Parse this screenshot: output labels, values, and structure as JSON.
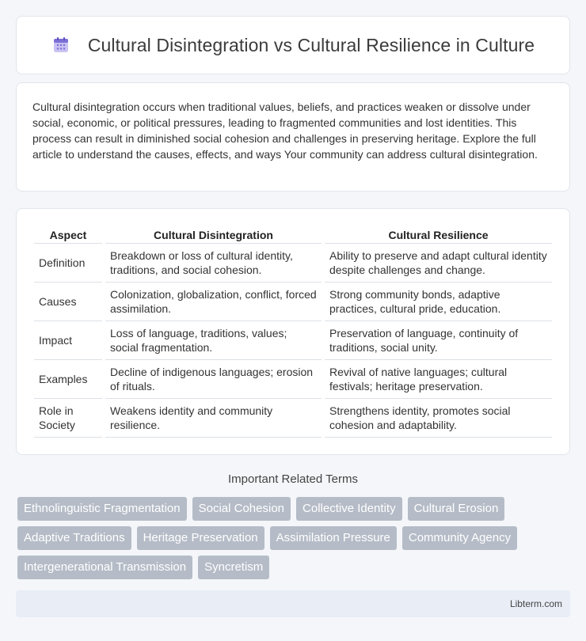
{
  "header": {
    "title": "Cultural Disintegration vs Cultural Resilience in Culture",
    "icon": "calendar-grid-icon"
  },
  "intro": {
    "text": "Cultural disintegration occurs when traditional values, beliefs, and practices weaken or dissolve under social, economic, or political pressures, leading to fragmented communities and lost identities. This process can result in diminished social cohesion and challenges in preserving heritage. Explore the full article to understand the causes, effects, and ways Your community can address cultural disintegration."
  },
  "table": {
    "headers": [
      "Aspect",
      "Cultural Disintegration",
      "Cultural Resilience"
    ],
    "rows": [
      [
        "Definition",
        "Breakdown or loss of cultural identity, traditions, and social cohesion.",
        "Ability to preserve and adapt cultural identity despite challenges and change."
      ],
      [
        "Causes",
        "Colonization, globalization, conflict, forced assimilation.",
        "Strong community bonds, adaptive practices, cultural pride, education."
      ],
      [
        "Impact",
        "Loss of language, traditions, values; social fragmentation.",
        "Preservation of language, continuity of traditions, social unity."
      ],
      [
        "Examples",
        "Decline of indigenous languages; erosion of rituals.",
        "Revival of native languages; cultural festivals; heritage preservation."
      ],
      [
        "Role in Society",
        "Weakens identity and community resilience.",
        "Strengthens identity, promotes social cohesion and adaptability."
      ]
    ]
  },
  "related": {
    "heading": "Important Related Terms",
    "tags": [
      "Ethnolinguistic Fragmentation",
      "Social Cohesion",
      "Collective Identity",
      "Cultural Erosion",
      "Adaptive Traditions",
      "Heritage Preservation",
      "Assimilation Pressure",
      "Community Agency",
      "Intergenerational Transmission",
      "Syncretism"
    ]
  },
  "footer": {
    "text": "Libterm.com"
  },
  "colors": {
    "tag_bg": "#b5bcc7",
    "footer_bg": "#e8edf6",
    "icon_purple": "#7b6fd6"
  }
}
